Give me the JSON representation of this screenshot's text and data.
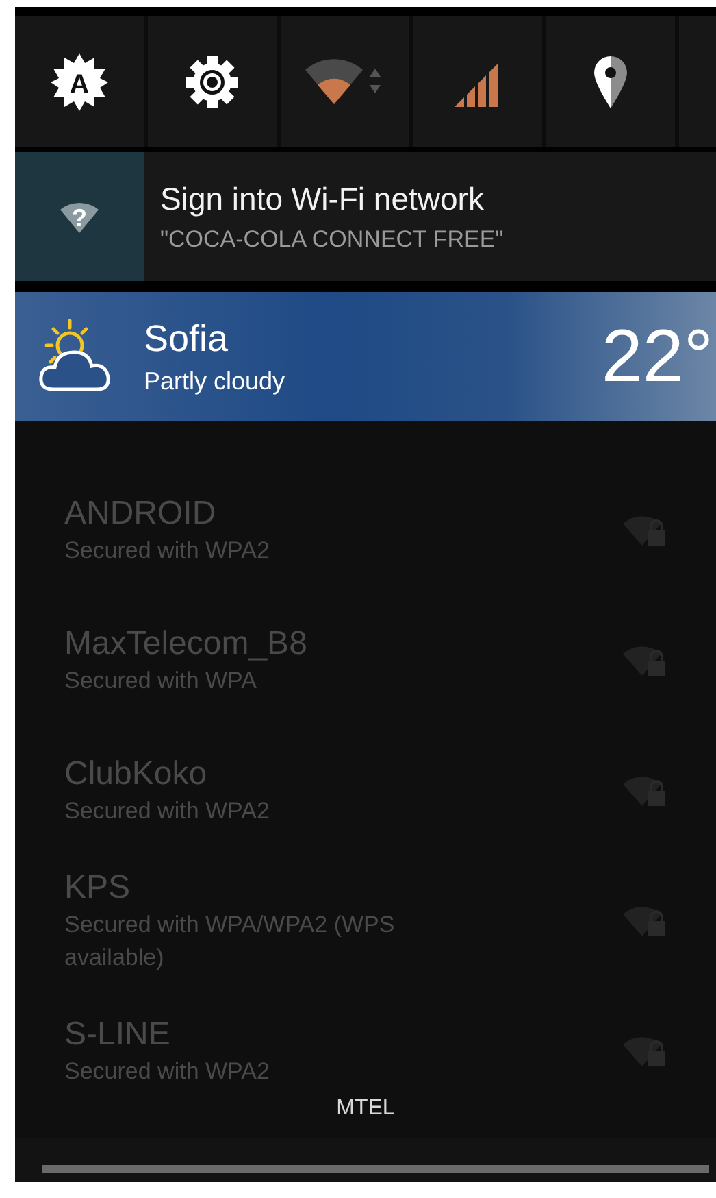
{
  "quick_settings": [
    {
      "kind": "auto-brightness",
      "glyph": "A"
    },
    {
      "kind": "settings"
    },
    {
      "kind": "wifi"
    },
    {
      "kind": "signal"
    },
    {
      "kind": "location"
    },
    {
      "kind": "blank"
    }
  ],
  "notification": {
    "icon_glyph": "?",
    "title": "Sign into Wi-Fi network",
    "text": "\"COCA-COLA CONNECT FREE\""
  },
  "weather": {
    "city": "Sofia",
    "condition": "Partly cloudy",
    "temperature": "22°"
  },
  "background_networks": [
    {
      "name": "ANDROID",
      "security": "Secured with WPA2"
    },
    {
      "name": "MaxTelecom_B8",
      "security": "Secured with WPA"
    },
    {
      "name": "ClubKoko",
      "security": "Secured with WPA2"
    },
    {
      "name": "KPS",
      "security": "Secured with WPA/WPA2 (WPS available)"
    },
    {
      "name": "S-LINE",
      "security": "Secured with WPA2"
    }
  ],
  "carrier": "MTEL"
}
